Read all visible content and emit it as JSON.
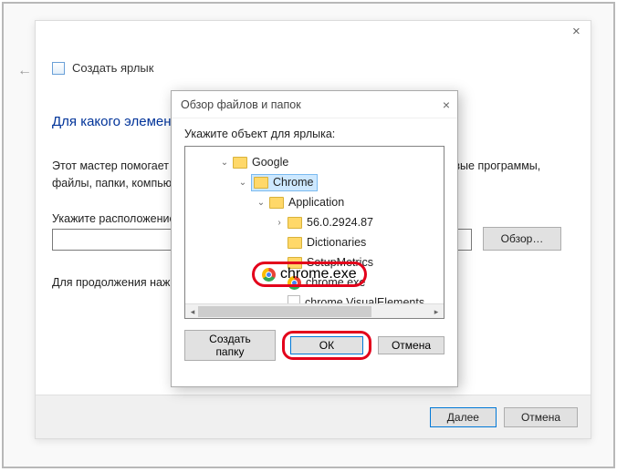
{
  "wizard": {
    "title": "Создать ярлык",
    "heading": "Для какого элемента нужно создать ярлык?",
    "desc": "Этот мастер помогает создать ярлык, указывающий на локальные или сетевые программы, файлы, папки, компьютеры или адреса в Интернете.",
    "location_label": "Укажите расположение объекта:",
    "browse_btn": "Обзор…",
    "continue_text": "Для продолжения нажмите кнопку \"Далее\".",
    "next_btn": "Далее",
    "cancel_btn": "Отмена"
  },
  "dialog": {
    "title": "Обзор файлов и папок",
    "prompt": "Укажите объект для ярлыка:",
    "create_folder_btn": "Создать папку",
    "ok_btn": "ОК",
    "cancel_btn": "Отмена",
    "tree": {
      "n0": "Google",
      "n1": "Chrome",
      "n2": "Application",
      "n3": "56.0.2924.87",
      "n4": "Dictionaries",
      "n5": "SetupMetrics",
      "n6": "chrome.exe",
      "n7": "chrome.VisualElements"
    }
  }
}
